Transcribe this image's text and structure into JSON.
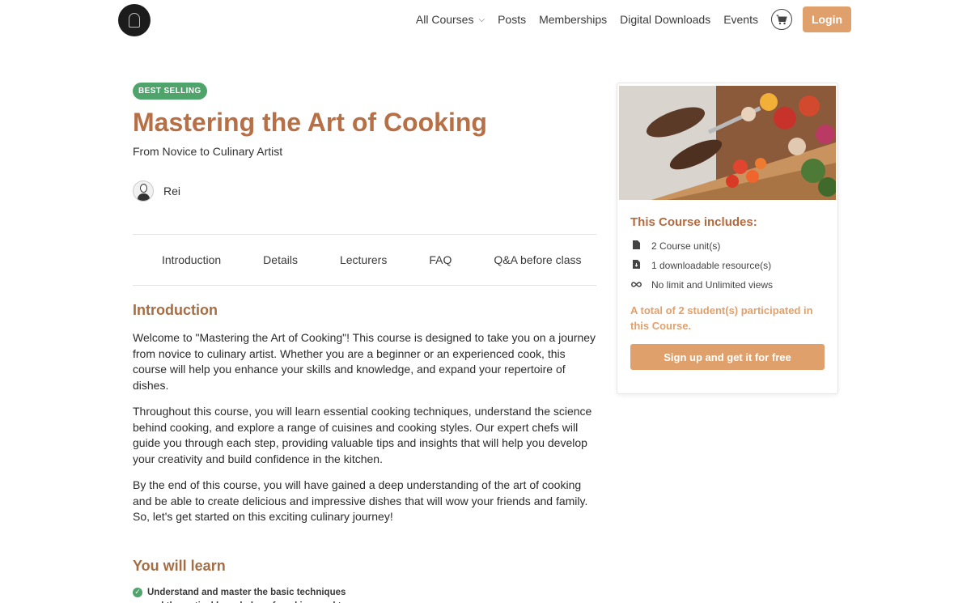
{
  "header": {
    "nav": [
      {
        "label": "All Courses",
        "has_dropdown": true
      },
      {
        "label": "Posts"
      },
      {
        "label": "Memberships"
      },
      {
        "label": "Digital Downloads"
      },
      {
        "label": "Events"
      }
    ],
    "cart_icon": "shopping-cart-icon",
    "login_label": "Login",
    "accent": "#e0a06b"
  },
  "course": {
    "badge": "BEST SELLING",
    "title": "Mastering the Art of Cooking",
    "subtitle": "From Novice to Culinary Artist",
    "author": "Rei"
  },
  "tabs": [
    "Introduction",
    "Details",
    "Lecturers",
    "FAQ",
    "Q&A before class"
  ],
  "introduction": {
    "heading": "Introduction",
    "paragraphs": [
      "Welcome to \"Mastering the Art of Cooking\"! This course is designed to take you on a journey from novice to culinary artist. Whether you are a beginner or an experienced cook, this course will help you enhance your skills and knowledge, and expand your repertoire of dishes.",
      "Throughout this course, you will learn essential cooking techniques, understand the science behind cooking, and explore a range of cuisines and cooking styles. Our expert chefs will guide you through each step, providing valuable tips and insights that will help you develop your creativity and build confidence in the kitchen.",
      "By the end of this course, you will have gained a deep understanding of the art of cooking and be able to create delicious and impressive dishes that will wow your friends and family. So, let's get started on this exciting culinary journey!"
    ]
  },
  "learn": {
    "heading": "You will learn",
    "items": [
      "Understand and master the basic techniques and theoretical knowledge of cooking, and to"
    ]
  },
  "sidebar": {
    "heading": "This Course includes:",
    "features": [
      {
        "icon": "document-icon",
        "text": "2 Course unit(s)"
      },
      {
        "icon": "download-file-icon",
        "text": "1 downloadable resource(s)"
      },
      {
        "icon": "infinity-icon",
        "text": "No limit and Unlimited views"
      }
    ],
    "participated": "A total of 2 student(s) participated in this Course.",
    "signup_label": "Sign up and get it for free"
  }
}
